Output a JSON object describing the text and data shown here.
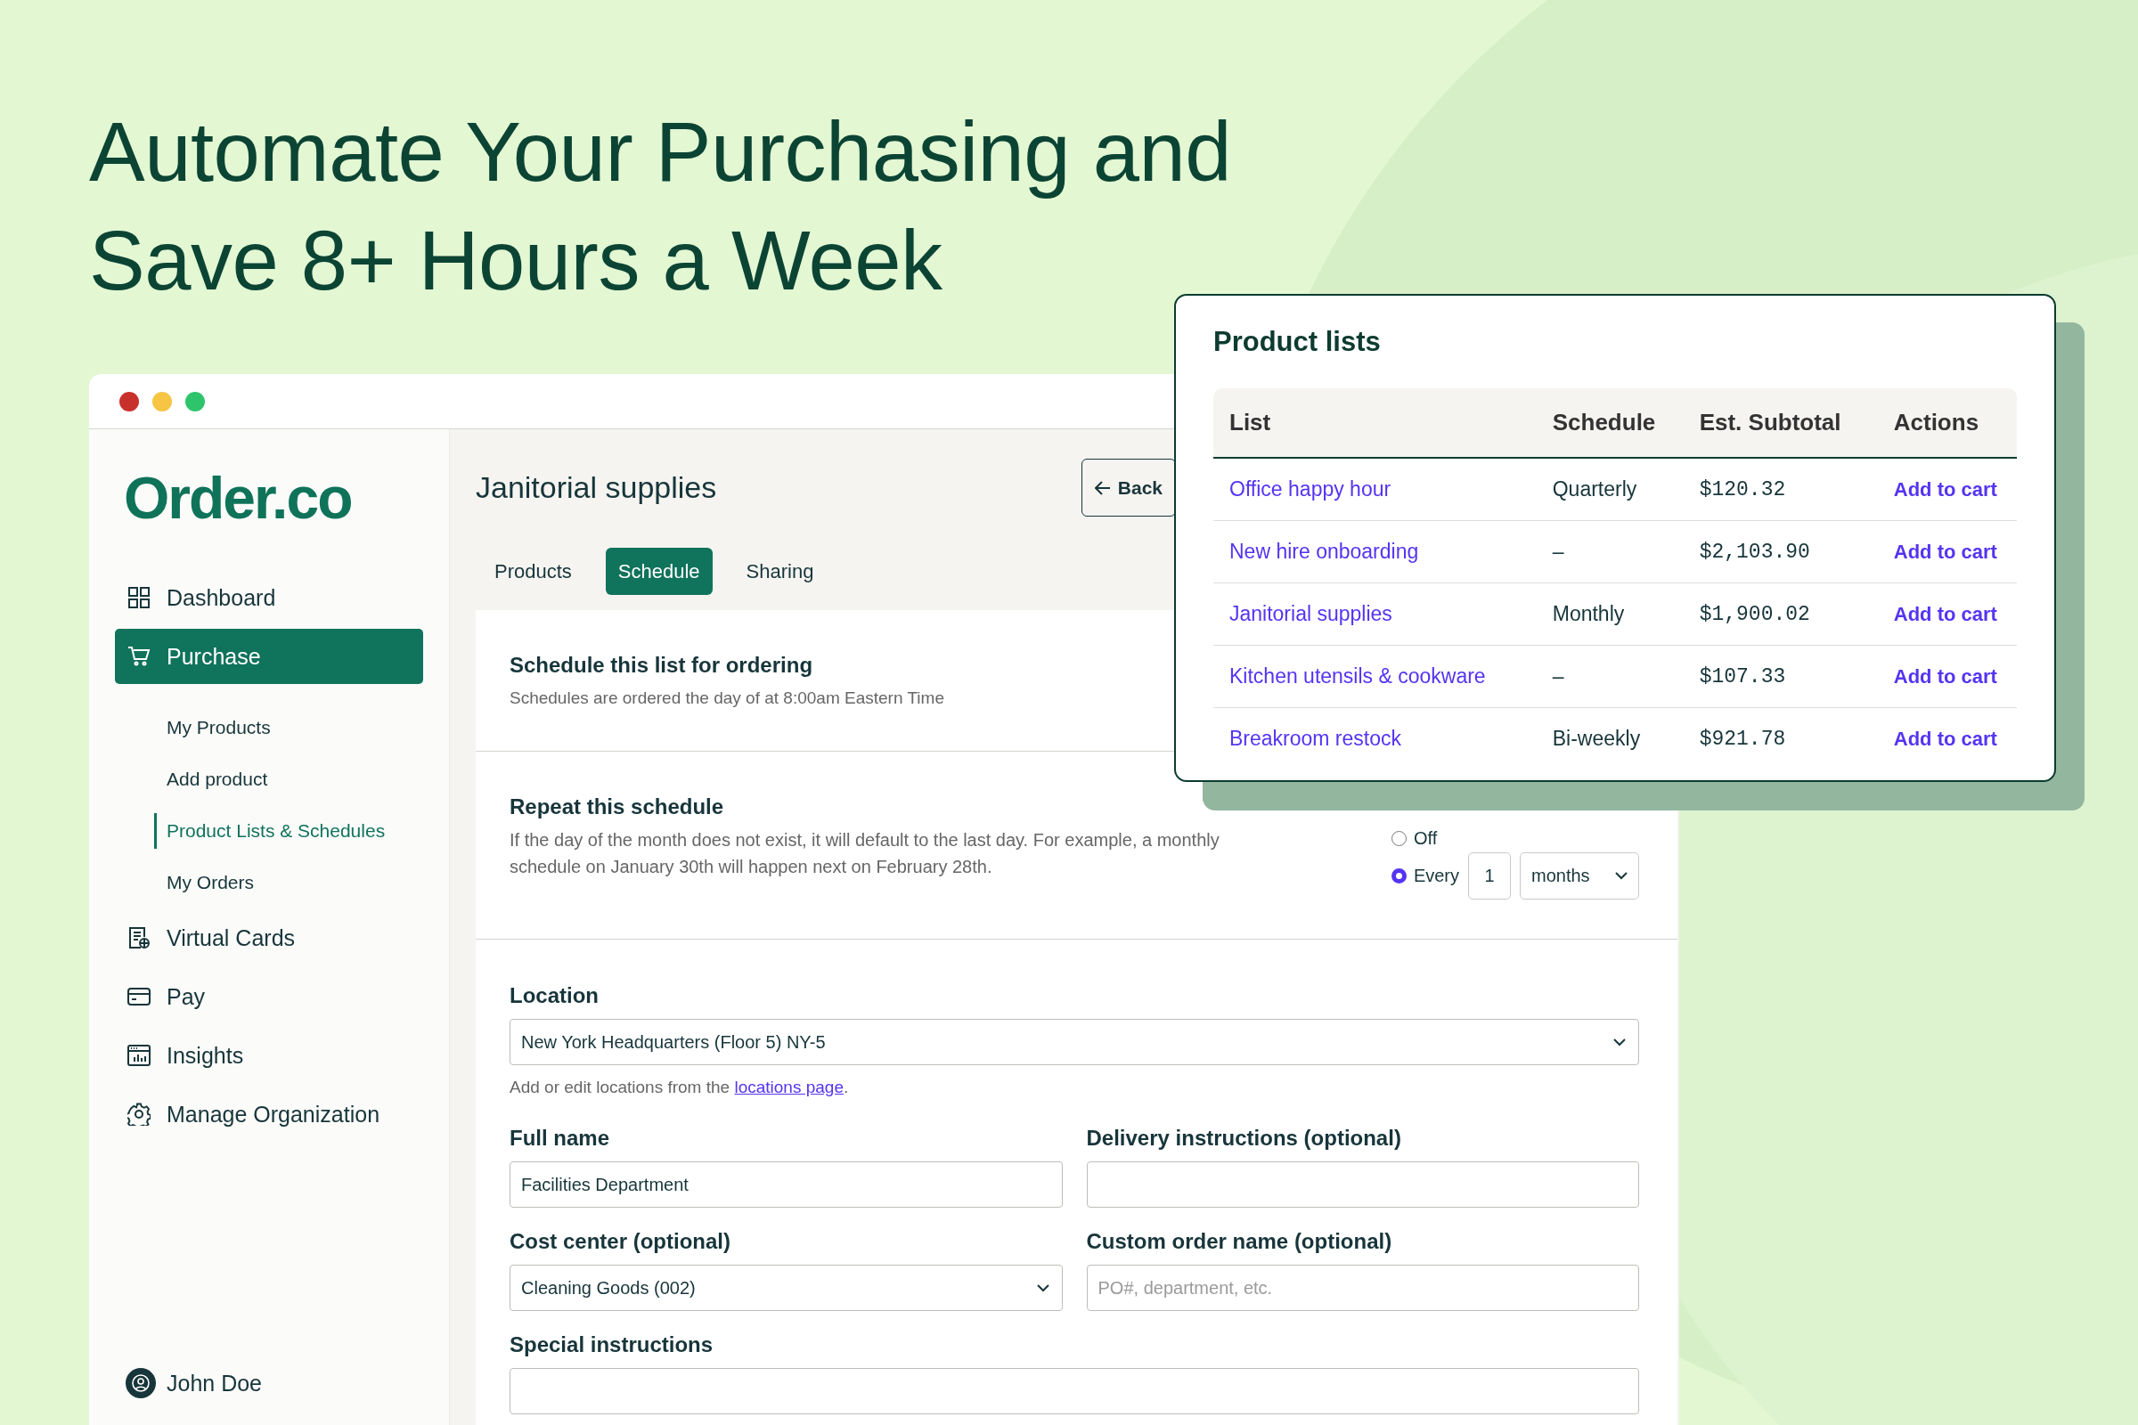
{
  "headline": [
    "Automate Your Purchasing and",
    "Save 8+ Hours a Week"
  ],
  "window": {
    "logo": "Order.co"
  },
  "sidebar": {
    "items": [
      {
        "label": "Dashboard",
        "kind": "grid",
        "selected": false
      },
      {
        "label": "Purchase",
        "kind": "cart",
        "selected": true,
        "children": [
          {
            "label": "My Products",
            "selected": false
          },
          {
            "label": "Add product",
            "selected": false
          },
          {
            "label": "Product Lists & Schedules",
            "selected": true
          },
          {
            "label": "My Orders",
            "selected": false
          }
        ]
      },
      {
        "label": "Virtual Cards",
        "kind": "card-globe",
        "selected": false
      },
      {
        "label": "Pay",
        "kind": "card",
        "selected": false
      },
      {
        "label": "Insights",
        "kind": "chart",
        "selected": false
      },
      {
        "label": "Manage Organization",
        "kind": "gear",
        "selected": false
      }
    ],
    "user": "John Doe"
  },
  "page": {
    "title": "Janitorial supplies",
    "back": "Back",
    "tabs": [
      {
        "label": "Products",
        "selected": false
      },
      {
        "label": "Schedule",
        "selected": true
      },
      {
        "label": "Sharing",
        "selected": false
      }
    ]
  },
  "schedule_section": {
    "title": "Schedule this list for ordering",
    "description": "Schedules are ordered the day of at 8:00am Eastern Time"
  },
  "repeat_section": {
    "title": "Repeat this schedule",
    "description": "If the day of the month does not exist, it will default to the last day. For example, a monthly schedule on January 30th will happen next on February 28th.",
    "options": [
      {
        "label": "Off",
        "selected": false
      },
      {
        "label": "Every",
        "selected": true
      }
    ],
    "interval": "1",
    "unit": "months"
  },
  "location": {
    "label": "Location",
    "value": "New York Headquarters (Floor 5) NY-5",
    "help": "Add or edit locations from the ",
    "help_link": "locations page",
    "help_end": "."
  },
  "fields": [
    {
      "label": "Full name",
      "kind": "input",
      "value": "Facilities Department"
    },
    {
      "label": "Delivery instructions (optional)",
      "kind": "input"
    },
    {
      "label": "Cost center (optional)",
      "kind": "select",
      "value": "Cleaning Goods (002)"
    },
    {
      "label": "Custom order name (optional)",
      "kind": "input",
      "placeholder": "PO#, department, etc."
    }
  ],
  "special_instructions": {
    "label": "Special instructions"
  },
  "product_lists": {
    "title": "Product lists",
    "columns": [
      "List",
      "Schedule",
      "Est. Subtotal",
      "Actions"
    ],
    "rows": [
      {
        "list": "Office happy hour",
        "schedule": "Quarterly",
        "subtotal": "$120.32",
        "action": "Add to cart"
      },
      {
        "list": "New hire onboarding",
        "schedule": "–",
        "subtotal": "$2,103.90",
        "action": "Add to cart"
      },
      {
        "list": "Janitorial supplies",
        "schedule": "Monthly",
        "subtotal": "$1,900.02",
        "action": "Add to cart"
      },
      {
        "list": "Kitchen utensils & cookware",
        "schedule": "–",
        "subtotal": "$107.33",
        "action": "Add to cart"
      },
      {
        "list": "Breakroom restock",
        "schedule": "Bi-weekly",
        "subtotal": "$921.78",
        "action": "Add to cart"
      }
    ]
  }
}
